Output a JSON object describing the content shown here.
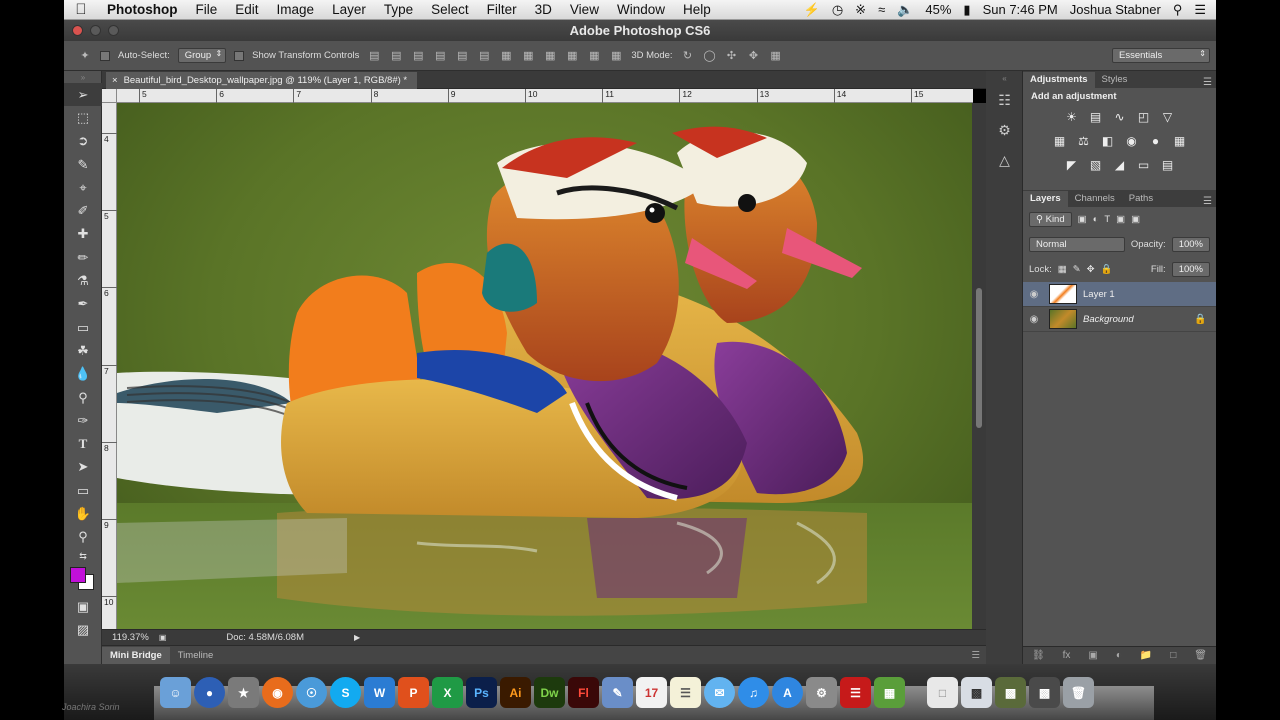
{
  "menubar": {
    "app_name": "Photoshop",
    "menus": [
      "File",
      "Edit",
      "Image",
      "Layer",
      "Type",
      "Select",
      "Filter",
      "3D",
      "View",
      "Window",
      "Help"
    ],
    "battery": "45%",
    "clock": "Sun 7:46 PM",
    "user": "Joshua Stabner"
  },
  "window": {
    "title": "Adobe Photoshop CS6"
  },
  "options": {
    "auto_select_label": "Auto-Select:",
    "auto_select_value": "Group",
    "transform_label": "Show Transform Controls",
    "mode_3d_label": "3D Mode:",
    "workspace": "Essentials"
  },
  "document": {
    "tab_title": "Beautiful_bird_Desktop_wallpaper.jpg @ 119% (Layer 1, RGB/8#) *",
    "ruler_h": [
      "5",
      "6",
      "7",
      "8",
      "9",
      "10",
      "11",
      "12",
      "13",
      "14",
      "15"
    ],
    "ruler_v": [
      "4",
      "5",
      "6",
      "7",
      "8",
      "9",
      "10",
      "11"
    ],
    "zoom": "119.37%",
    "doc_size": "Doc: 4.58M/6.08M"
  },
  "bottom_tabs": [
    "Mini Bridge",
    "Timeline"
  ],
  "panels": {
    "adjust_tabs": [
      "Adjustments",
      "Styles"
    ],
    "add_adjustment": "Add an adjustment",
    "layer_tabs": [
      "Layers",
      "Channels",
      "Paths"
    ],
    "kind_filter": "Kind",
    "blend_mode": "Normal",
    "opacity_label": "Opacity:",
    "opacity_value": "100%",
    "lock_label": "Lock:",
    "fill_label": "Fill:",
    "fill_value": "100%",
    "layers": [
      {
        "name": "Layer 1",
        "selected": true
      },
      {
        "name": "Background",
        "selected": false
      }
    ]
  },
  "dock": {
    "user_watermark": "Joachira Sorin"
  },
  "colors": {
    "foreground": "#c20fd9",
    "background": "#ffffff"
  }
}
